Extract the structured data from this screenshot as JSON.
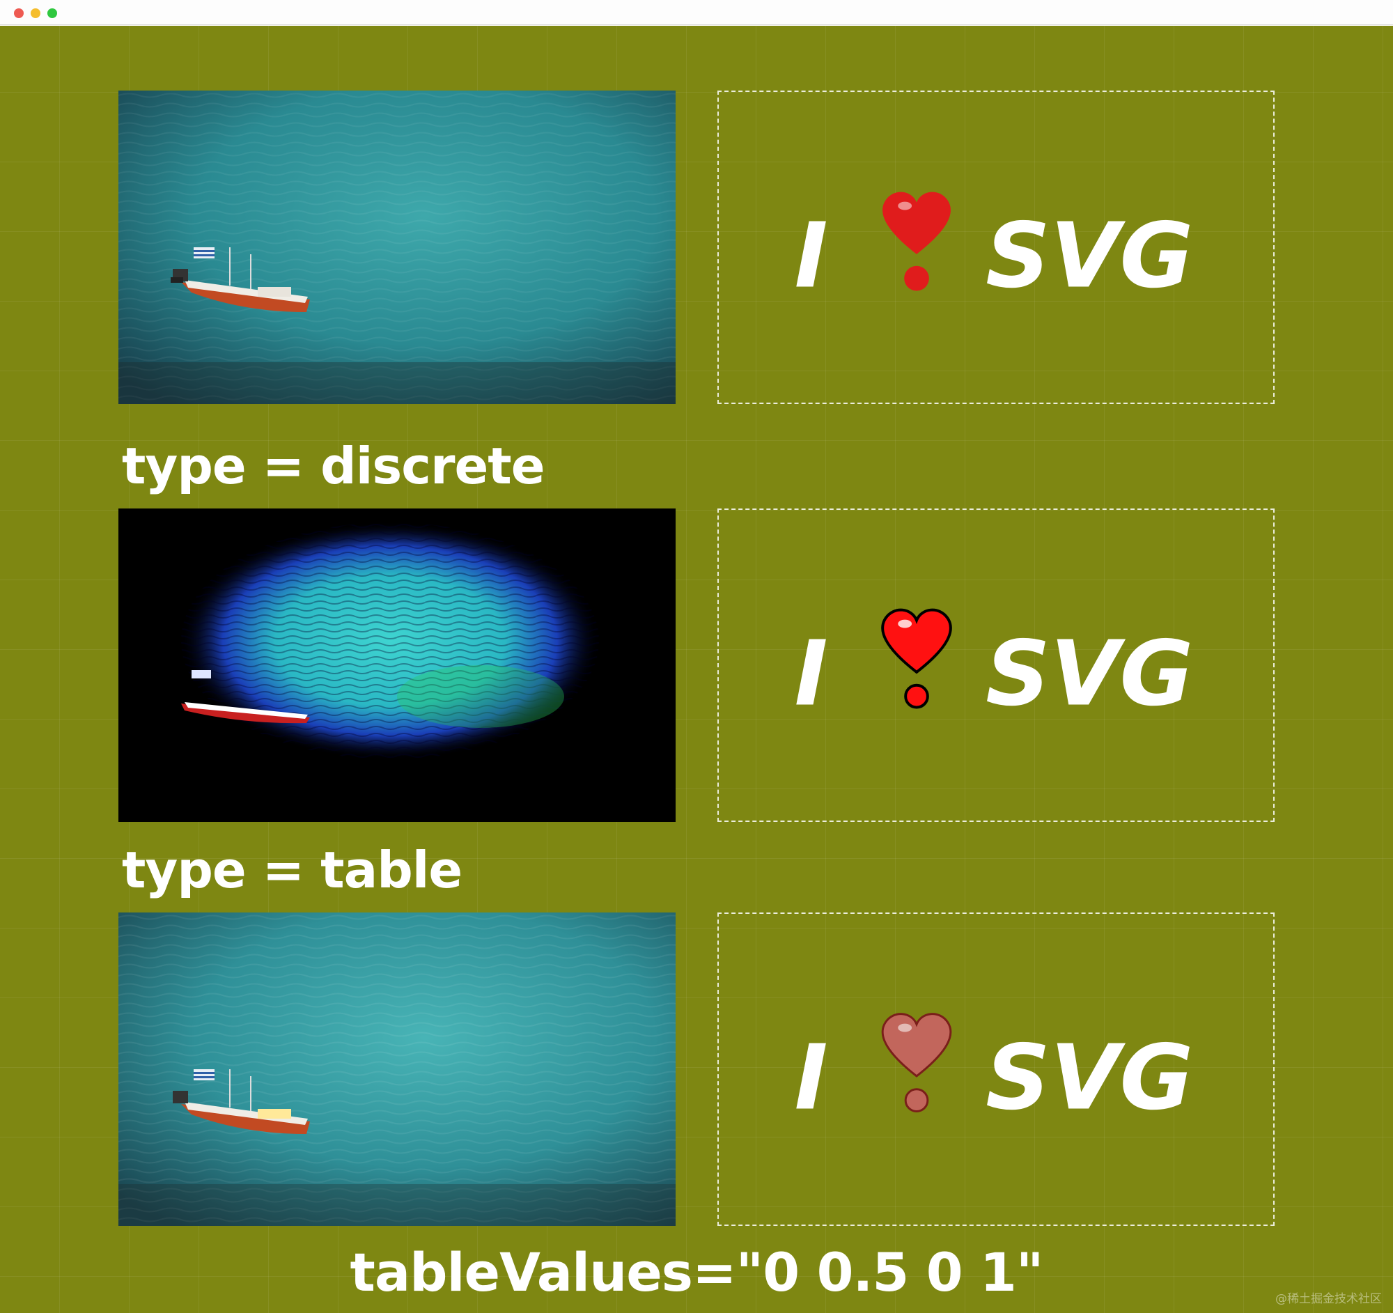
{
  "window": {
    "controls": [
      "close",
      "minimize",
      "maximize"
    ]
  },
  "colors": {
    "canvas_background": "#7e8712",
    "window_close": "#ee5a52",
    "window_minimize": "#f5bd2d",
    "window_maximize": "#2fc83f",
    "water": "#2f8e94",
    "heart": "#e01c1c",
    "text": "#ffffff"
  },
  "rows": [
    {
      "photo_variant": "original",
      "logo": {
        "left_word": "I",
        "icon": "heart-exclamation-icon",
        "right_word": "SVG"
      }
    },
    {
      "photo_variant": "discrete",
      "logo": {
        "left_word": "I",
        "icon": "heart-exclamation-icon",
        "right_word": "SVG"
      }
    },
    {
      "photo_variant": "table",
      "logo": {
        "left_word": "I",
        "icon": "heart-exclamation-icon",
        "right_word": "SVG"
      }
    }
  ],
  "captions": {
    "discrete": "type = discrete",
    "table": "type = table",
    "table_values": "tableValues=\"0 0.5 0 1\""
  },
  "watermark": "@稀土掘金技术社区"
}
